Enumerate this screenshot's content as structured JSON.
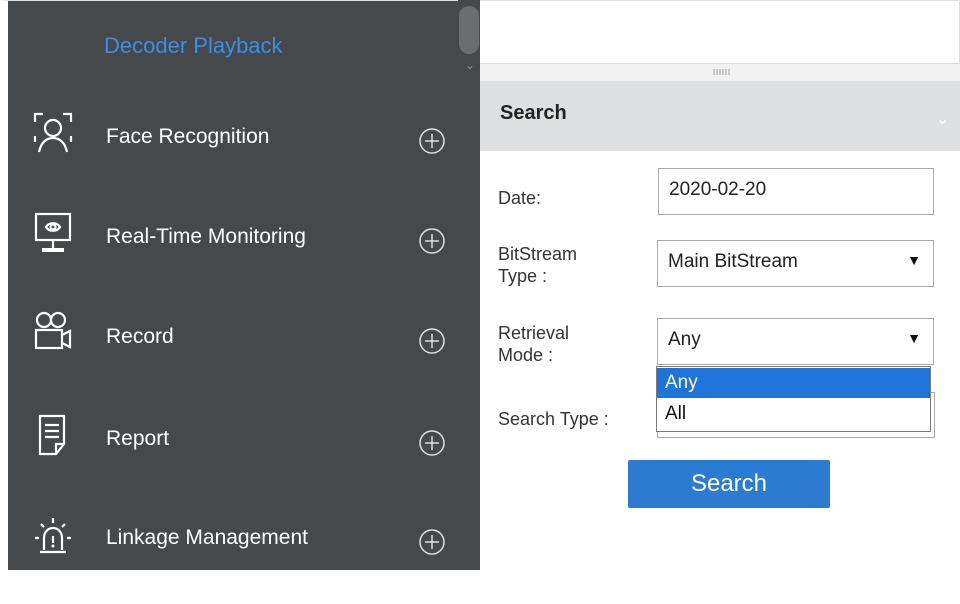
{
  "sidebar": {
    "title": "Decoder Playback",
    "items": [
      {
        "label": "Face Recognition",
        "icon": "face-icon"
      },
      {
        "label": "Real-Time Monitoring",
        "icon": "monitor-icon"
      },
      {
        "label": "Record",
        "icon": "video-camera-icon"
      },
      {
        "label": "Report",
        "icon": "report-icon"
      },
      {
        "label": "Linkage Management",
        "icon": "alarm-icon"
      }
    ]
  },
  "panel": {
    "header": "Search",
    "date_label": "Date:",
    "date_value": "2020-02-20",
    "bitstream_label_1": "BitStream",
    "bitstream_label_2": "Type :",
    "bitstream_value": "Main BitStream",
    "retrieval_label_1": "Retrieval",
    "retrieval_label_2": "Mode :",
    "retrieval_value": "Any",
    "retrieval_options": [
      "Any",
      "All"
    ],
    "search_type_label": "Search Type :",
    "search_button": "Search"
  },
  "colors": {
    "sidebar_bg": "#46494b",
    "title_blue": "#3a8ee6",
    "accent": "#2a7bd1",
    "selected_option": "#1e74d8"
  }
}
